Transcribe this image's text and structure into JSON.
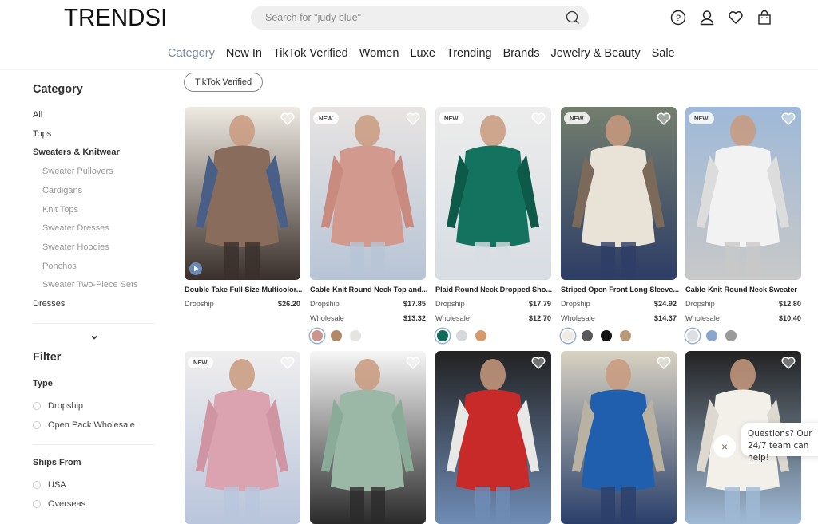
{
  "header": {
    "logo": "TRENDSI",
    "search_placeholder": "Search for \"judy blue\"",
    "icons": [
      "help-icon",
      "account-icon",
      "wishlist-icon",
      "cart-icon"
    ]
  },
  "nav": {
    "items": [
      {
        "label": "Category",
        "active": true
      },
      {
        "label": "New In"
      },
      {
        "label": "TikTok Verified"
      },
      {
        "label": "Women"
      },
      {
        "label": "Luxe"
      },
      {
        "label": "Trending"
      },
      {
        "label": "Brands"
      },
      {
        "label": "Jewelry & Beauty"
      },
      {
        "label": "Sale"
      }
    ]
  },
  "sidebar": {
    "category_title": "Category",
    "categories": [
      {
        "label": "All"
      },
      {
        "label": "Tops"
      },
      {
        "label": "Sweaters & Knitwear",
        "selected": true
      },
      {
        "label": "Sweater Pullovers",
        "sub": true
      },
      {
        "label": "Cardigans",
        "sub": true
      },
      {
        "label": "Knit Tops",
        "sub": true
      },
      {
        "label": "Sweater Dresses",
        "sub": true
      },
      {
        "label": "Sweater Hoodies",
        "sub": true
      },
      {
        "label": "Ponchos",
        "sub": true
      },
      {
        "label": "Sweater Two-Piece Sets",
        "sub": true
      },
      {
        "label": "Dresses"
      }
    ],
    "filter_title": "Filter",
    "type_title": "Type",
    "type_options": [
      "Dropship",
      "Open Pack Wholesale"
    ],
    "ships_title": "Ships From",
    "ships_options": [
      "USA",
      "Overseas"
    ]
  },
  "active_tag": "TikTok Verified",
  "products": [
    {
      "name": "Double Take Full Size Multicolor...",
      "dropship_label": "Dropship",
      "dropship": "$26.20",
      "badge": "",
      "video": true,
      "colors": [
        "#8a6c5c",
        "#4a5f88",
        "#eeeae2",
        "#3a2f2a"
      ],
      "swatches": []
    },
    {
      "name": "Cable-Knit Round Neck Top and...",
      "dropship_label": "Dropship",
      "dropship": "$17.85",
      "wholesale_label": "Wholesale",
      "wholesale": "$13.32",
      "badge": "NEW",
      "colors": [
        "#d29a8f",
        "#c98a80",
        "#e8e4e2",
        "#b7c4d6"
      ],
      "swatches": [
        "#c9958c",
        "#b08a66",
        "#e6e4e0"
      ]
    },
    {
      "name": "Plaid Round Neck Dropped Sho...",
      "dropship_label": "Dropship",
      "dropship": "$17.79",
      "wholesale_label": "Wholesale",
      "wholesale": "$12.70",
      "badge": "NEW",
      "colors": [
        "#14735e",
        "#0e5a4a",
        "#ececec",
        "#d8dde3"
      ],
      "swatches": [
        "#0f6b5a",
        "#d6d8de",
        "#d59a6c"
      ]
    },
    {
      "name": "Striped Open Front Long Sleeve...",
      "dropship_label": "Dropship",
      "dropship": "$24.92",
      "wholesale_label": "Wholesale",
      "wholesale": "$14.37",
      "badge": "NEW",
      "colors": [
        "#e9e2d6",
        "#7b6a5a",
        "#737e6e",
        "#2d3d66"
      ],
      "swatches": [
        "#efebe4",
        "#5a5a5a",
        "#111111",
        "#b89a78"
      ]
    },
    {
      "name": "Cable-Knit Round Neck Sweater",
      "dropship_label": "Dropship",
      "dropship": "$12.80",
      "wholesale_label": "Wholesale",
      "wholesale": "$10.40",
      "badge": "NEW",
      "colors": [
        "#f2f2f2",
        "#dcdcdc",
        "#9fb9d8",
        "#c8c8c8"
      ],
      "swatches": [
        "#dcdfe4",
        "#8aa6cc",
        "#9a9a9a"
      ]
    },
    {
      "name": "",
      "badge": "NEW",
      "colors": [
        "#dba3b0",
        "#cf95a3",
        "#f0eeee",
        "#b9c5dc"
      ]
    },
    {
      "name": "",
      "badge": "",
      "colors": [
        "#9bb7a6",
        "#8aab98",
        "#f6f6f6",
        "#2a2a2a"
      ]
    },
    {
      "name": "",
      "badge": "",
      "colors": [
        "#c82a2a",
        "#e8e8e6",
        "#222",
        "#6f8cb5"
      ]
    },
    {
      "name": "",
      "badge": "",
      "colors": [
        "#1f5fae",
        "#b9b2a2",
        "#d8d2c2",
        "#2a3f6a"
      ]
    },
    {
      "name": "",
      "badge": "",
      "colors": [
        "#f3f0ea",
        "#ddd8d0",
        "#222",
        "#9fb9d5"
      ]
    }
  ],
  "chat": {
    "text": "Questions? Our 24/7 team can help!",
    "close": "×"
  }
}
